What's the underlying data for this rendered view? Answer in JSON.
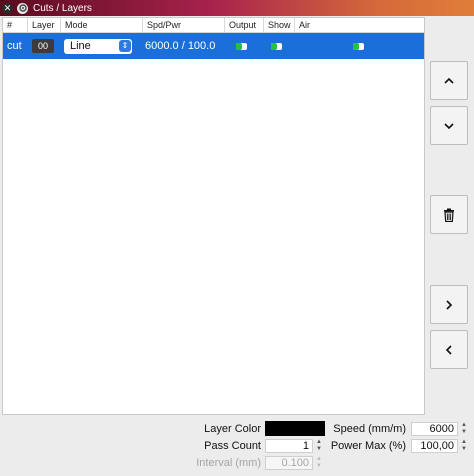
{
  "window": {
    "title": "Cuts / Layers"
  },
  "table": {
    "columns": [
      "#",
      "Layer",
      "Mode",
      "Spd/Pwr",
      "Output",
      "Show",
      "Air"
    ],
    "rows": [
      {
        "name": "cut",
        "layer": "00",
        "mode": "Line",
        "spd_pwr": "6000.0 / 100.0",
        "output": true,
        "show": true,
        "air": true,
        "selected": true
      }
    ]
  },
  "side_buttons": [
    "move-up",
    "move-down",
    "delete",
    "next",
    "previous"
  ],
  "form": {
    "layer_color_label": "Layer Color",
    "layer_color": "#000000",
    "pass_count_label": "Pass Count",
    "pass_count": "1",
    "interval_label": "Interval (mm)",
    "interval": "0.100",
    "speed_label": "Speed (mm/m)",
    "speed": "6000",
    "power_max_label": "Power Max (%)",
    "power_max": "100,00"
  },
  "colors": {
    "selection": "#1a6fd8",
    "toggle_on": "#22c43a"
  }
}
